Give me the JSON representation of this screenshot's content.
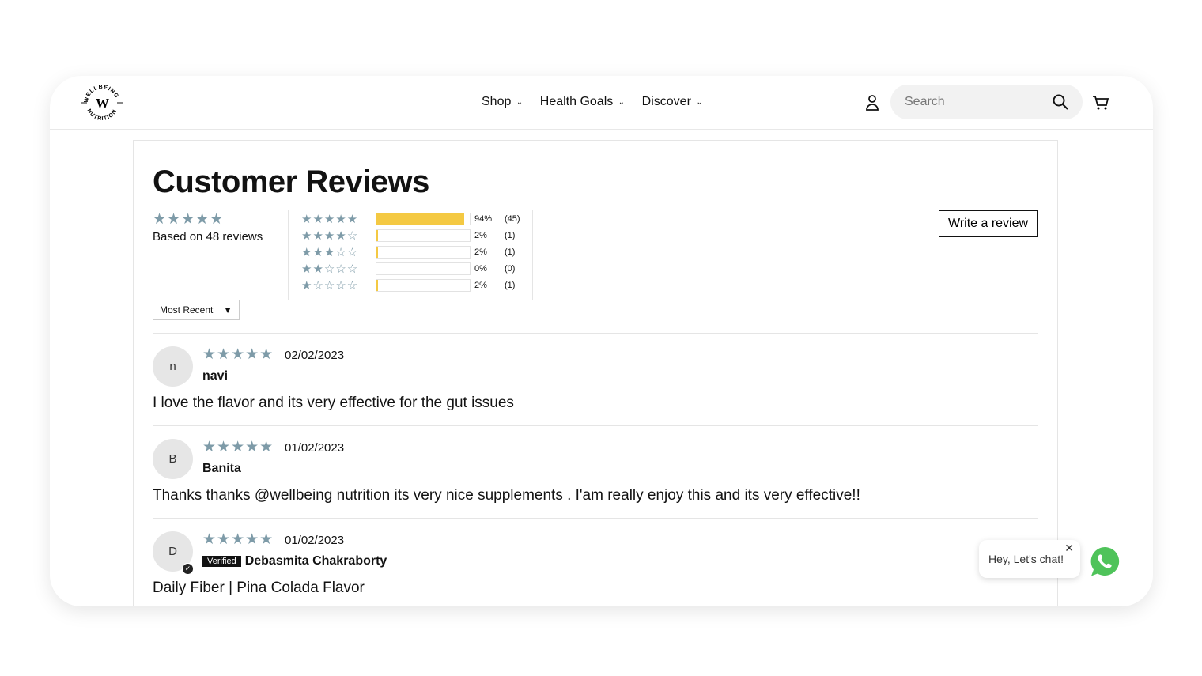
{
  "header": {
    "logo_text": "WELLBEING NUTRITION",
    "nav": [
      {
        "label": "Shop"
      },
      {
        "label": "Health Goals"
      },
      {
        "label": "Discover"
      }
    ],
    "search_placeholder": "Search"
  },
  "reviews": {
    "title": "Customer Reviews",
    "average_stars": 5,
    "based_on": "Based on 48 reviews",
    "write_label": "Write a review",
    "sort": "Most Recent",
    "histogram": [
      {
        "stars": 5,
        "pct": "94%",
        "count": "(45)",
        "fill": 94
      },
      {
        "stars": 4,
        "pct": "2%",
        "count": "(1)",
        "fill": 2
      },
      {
        "stars": 3,
        "pct": "2%",
        "count": "(1)",
        "fill": 2
      },
      {
        "stars": 2,
        "pct": "0%",
        "count": "(0)",
        "fill": 0
      },
      {
        "stars": 1,
        "pct": "2%",
        "count": "(1)",
        "fill": 2
      }
    ],
    "items": [
      {
        "initial": "n",
        "rating": 5,
        "date": "02/02/2023",
        "name": "navi",
        "verified": false,
        "body": "I love the flavor and its very effective for the gut issues"
      },
      {
        "initial": "B",
        "rating": 5,
        "date": "01/02/2023",
        "name": "Banita",
        "verified": false,
        "body": "Thanks thanks @wellbeing nutrition its very nice supplements . I'am really enjoy this and its very effective!!"
      },
      {
        "initial": "D",
        "rating": 5,
        "date": "01/02/2023",
        "name": "Debasmita Chakraborty",
        "verified": true,
        "verified_label": "Verified",
        "body": "Daily Fiber | Pina Colada Flavor"
      }
    ]
  },
  "chat": {
    "text": "Hey, Let's chat!"
  },
  "colors": {
    "star": "#7e9ba8",
    "bar": "#f4c943",
    "whatsapp": "#4fc35a"
  }
}
